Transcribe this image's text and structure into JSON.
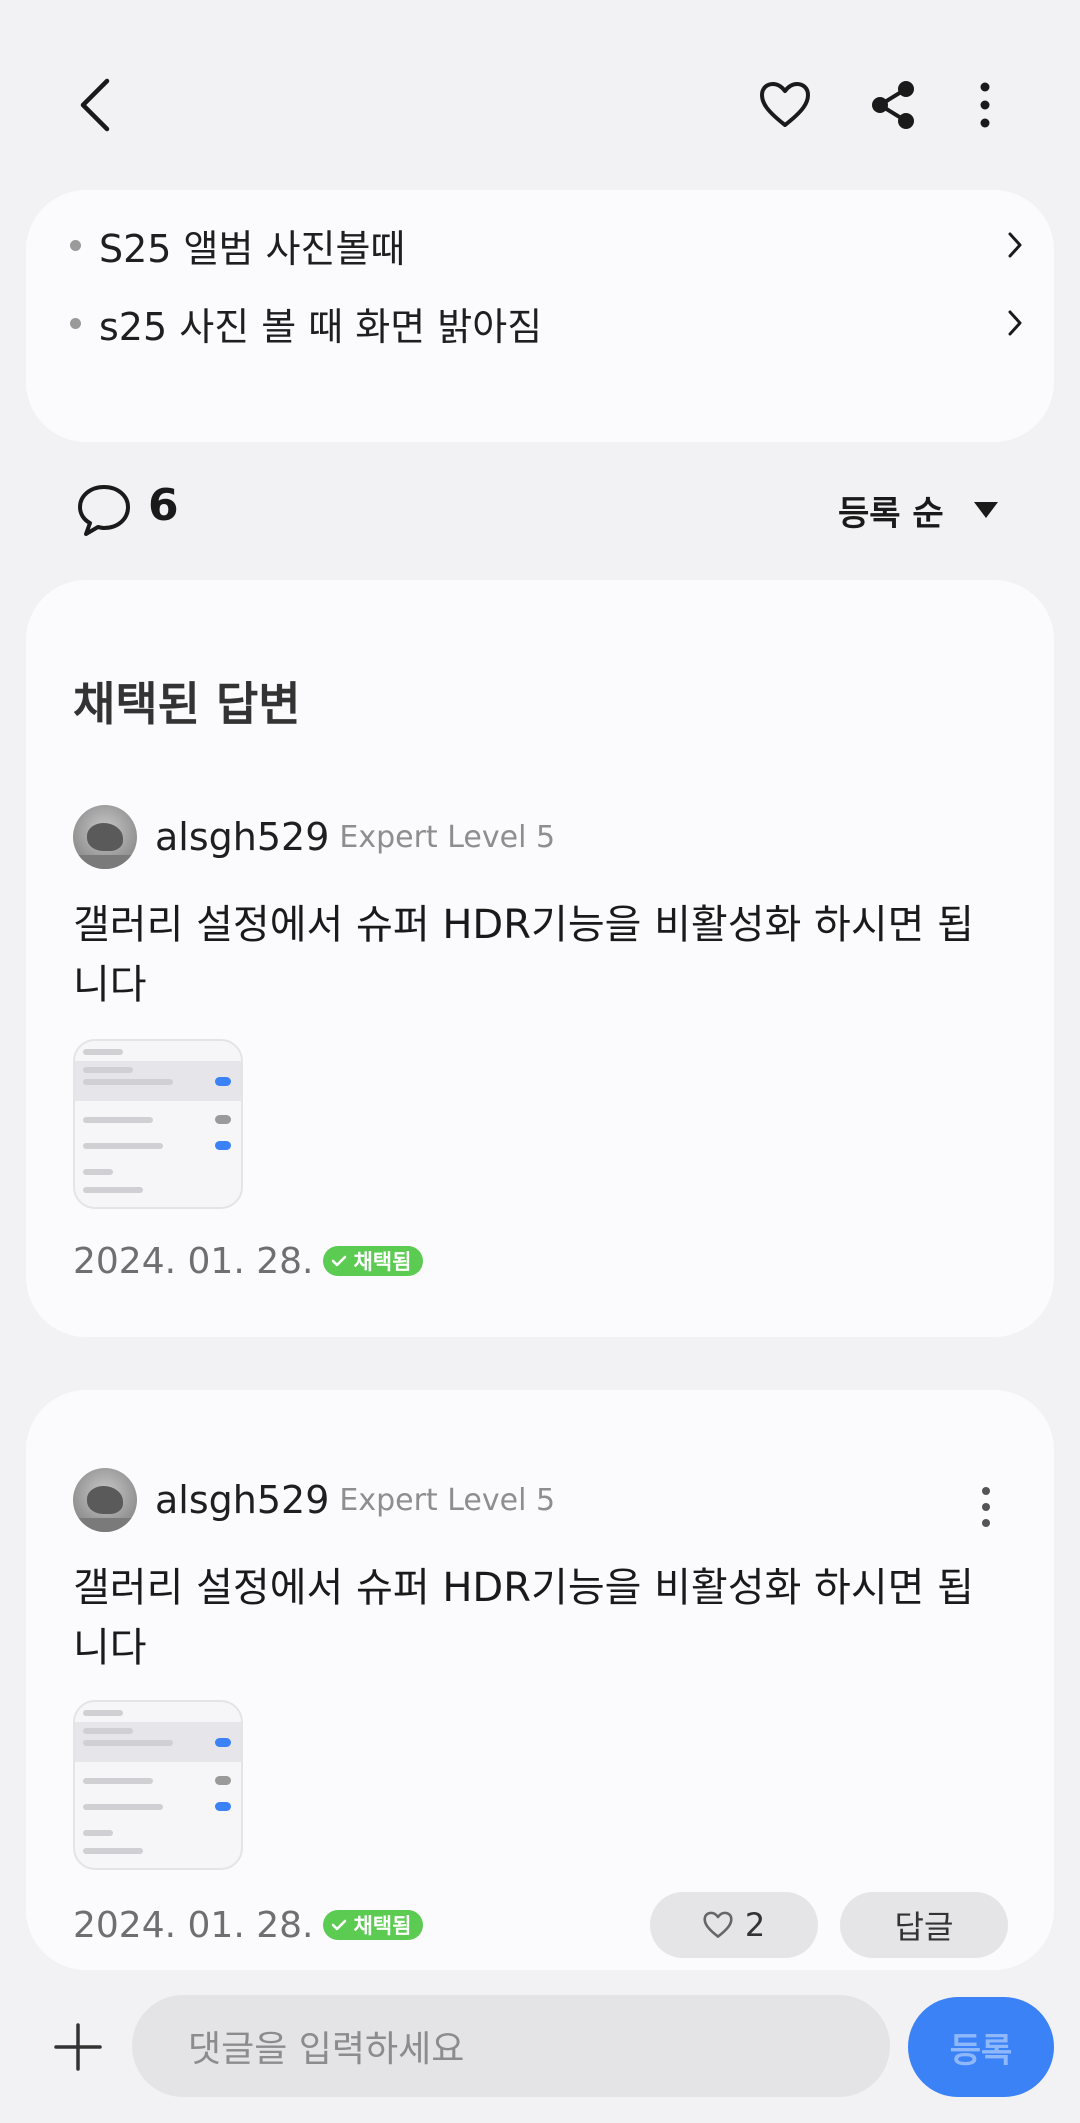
{
  "header": {
    "back_icon": "chevron-left-icon",
    "favorite_icon": "heart-icon",
    "share_icon": "share-icon",
    "more_icon": "more-vertical-icon"
  },
  "related": {
    "items": [
      {
        "label": "S25 앨범 사진볼때"
      },
      {
        "label": "s25 사진 볼 때 화면 밝아짐"
      }
    ]
  },
  "comments_bar": {
    "count": "6",
    "sort_label": "등록 순"
  },
  "accepted": {
    "section_title": "채택된 답변",
    "username": "alsgh529",
    "level": "Expert Level 5",
    "text": "갤러리 설정에서 슈퍼 HDR기능을 비활성화 하시면 됩니다",
    "date": "2024. 01. 28.",
    "badge": "채택됨"
  },
  "answer": {
    "username": "alsgh529",
    "level": "Expert Level 5",
    "text": "갤러리 설정에서 슈퍼 HDR기능을 비활성화 하시면 됩니다",
    "date": "2024. 01. 28.",
    "badge": "채택됨",
    "like_count": "2",
    "reply_label": "답글"
  },
  "composer": {
    "placeholder": "댓글을 입력하세요",
    "submit_label": "등록"
  },
  "colors": {
    "accent": "#3b82f6",
    "badge_green": "#5ccb52",
    "card_bg": "#fbfbfd",
    "page_bg": "#f2f2f4"
  }
}
